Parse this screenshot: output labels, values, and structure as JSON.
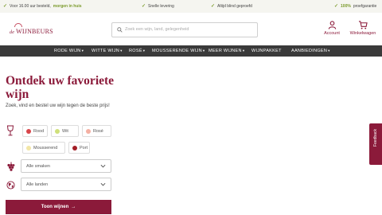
{
  "topbar": {
    "usps": [
      {
        "text": "Voor 16.00 uur besteld,",
        "highlight": "morgen in huis"
      },
      {
        "text": "Snelle levering",
        "highlight": ""
      },
      {
        "text": "Altijd blind geproefd",
        "highlight": ""
      },
      {
        "text": "proefgarantie",
        "highlight": "100%"
      }
    ]
  },
  "header": {
    "logo_prefix": "de",
    "logo_name": "WIJNBEURS",
    "search_placeholder": "Zoek een wijn, land, gelegenheid",
    "account_label": "Account",
    "cart_label": "Winkelwagen"
  },
  "nav": {
    "items": [
      "RODE WIJN",
      "WITTE WIJN",
      "ROSÉ",
      "MOUSSERENDE WIJN",
      "MEER WIJNEN",
      "WIJNPAKKET",
      "AANBIEDINGEN"
    ]
  },
  "hero": {
    "title": "Ontdek uw favoriete wijn",
    "subtitle": "Zoek, vind en bestel uw wijn tegen de beste prijs!"
  },
  "filters": {
    "colors": [
      {
        "label": "Rood",
        "color": "#d8454a"
      },
      {
        "label": "Wit",
        "color": "#cfe07a"
      },
      {
        "label": "Rosé",
        "color": "#f4b0a3"
      },
      {
        "label": "Mousserend",
        "color": "#f2e6a6"
      },
      {
        "label": "Port",
        "color": "#a31d26"
      }
    ],
    "taste_select": "Alle smaken",
    "country_select": "Alle landen",
    "cta_label": "Toon wijnen"
  },
  "feedback_label": "Feedback",
  "colors": {
    "brand": "#8b1a3a",
    "nav": "#3a3a3a",
    "accent_green": "#7a9a2a"
  }
}
